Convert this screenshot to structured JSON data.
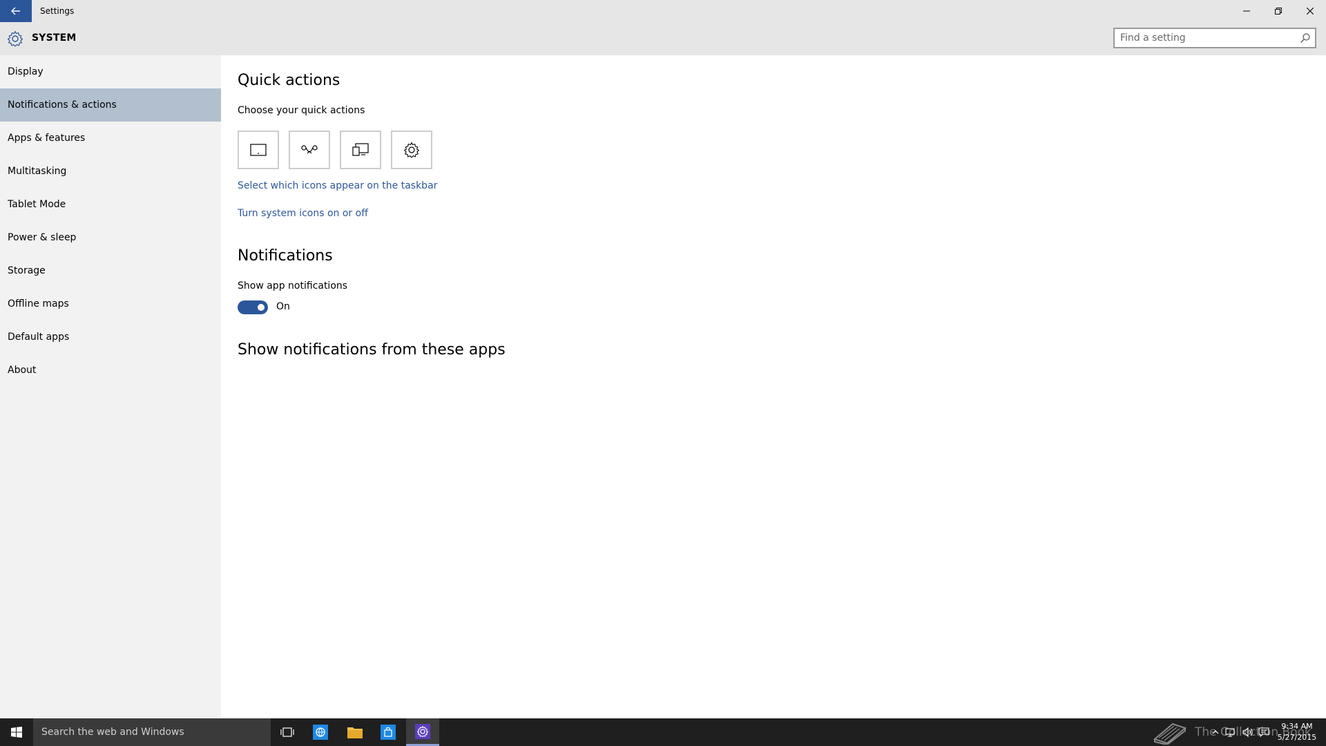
{
  "window": {
    "title": "Settings"
  },
  "header": {
    "section_title": "SYSTEM"
  },
  "search": {
    "placeholder": "Find a setting"
  },
  "sidebar": {
    "items": [
      {
        "label": "Display"
      },
      {
        "label": "Notifications & actions",
        "selected": true
      },
      {
        "label": "Apps & features"
      },
      {
        "label": "Multitasking"
      },
      {
        "label": "Tablet Mode"
      },
      {
        "label": "Power & sleep"
      },
      {
        "label": "Storage"
      },
      {
        "label": "Offline maps"
      },
      {
        "label": "Default apps"
      },
      {
        "label": "About"
      }
    ]
  },
  "main": {
    "quick_actions": {
      "title": "Quick actions",
      "subtitle": "Choose your quick actions",
      "tiles": [
        {
          "icon": "tablet-mode-icon"
        },
        {
          "icon": "connect-icon"
        },
        {
          "icon": "project-icon"
        },
        {
          "icon": "settings-gear-icon"
        }
      ],
      "link_taskbar_icons": "Select which icons appear on the taskbar",
      "link_system_icons": "Turn system icons on or off"
    },
    "notifications": {
      "title": "Notifications",
      "show_app_notifications_label": "Show app notifications",
      "toggle_state": "On",
      "toggle_on": true,
      "apps_title": "Show notifications from these apps"
    }
  },
  "taskbar": {
    "search_placeholder": "Search the web and Windows",
    "watermark": "The Collection Book",
    "clock_time": "9:34 AM",
    "clock_date": "5/27/2015"
  },
  "colors": {
    "accent": "#2b579a",
    "sidebar_selected": "#b1bfcf",
    "titlebar": "#e6e6e6",
    "taskbar": "#1f1f1f"
  }
}
